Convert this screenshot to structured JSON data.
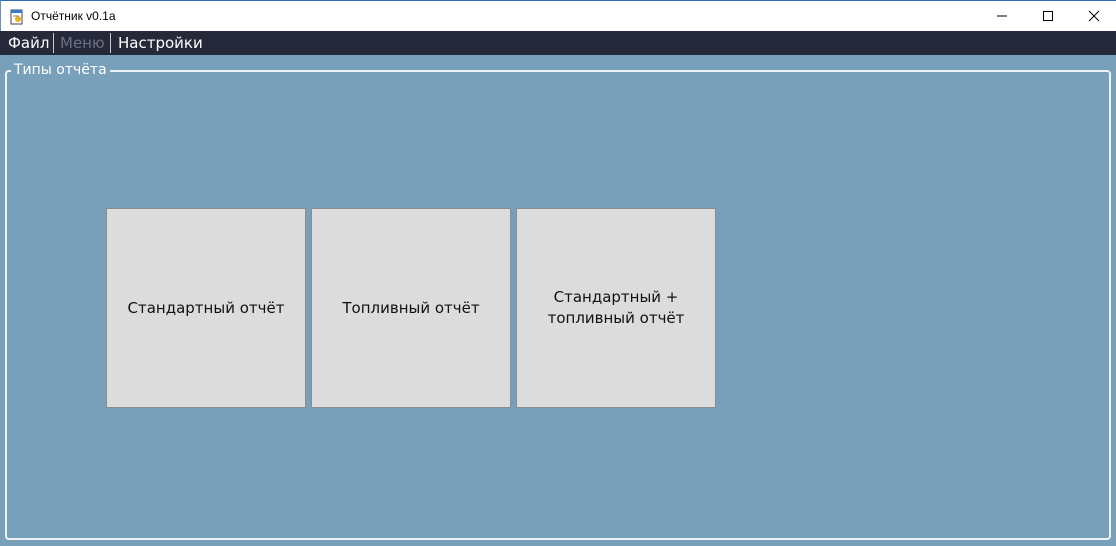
{
  "window": {
    "title": "Отчётник v0.1a",
    "icon": "notepad-app-icon",
    "controls": [
      "minimize-icon",
      "maximize-icon",
      "close-icon"
    ]
  },
  "menu": {
    "items": [
      {
        "label": "Файл",
        "enabled": true
      },
      {
        "label": "Меню",
        "enabled": false
      },
      {
        "label": "Настройки",
        "enabled": true
      }
    ]
  },
  "report_types": {
    "group_title": "Типы отчёта",
    "buttons": [
      {
        "label": "Стандартный отчёт"
      },
      {
        "label": "Топливный отчёт"
      },
      {
        "label": "Стандартный + топливный отчёт"
      }
    ]
  },
  "colors": {
    "background": "#79a0bb",
    "menubar": "#26293a",
    "button_face": "#dddcdc"
  }
}
